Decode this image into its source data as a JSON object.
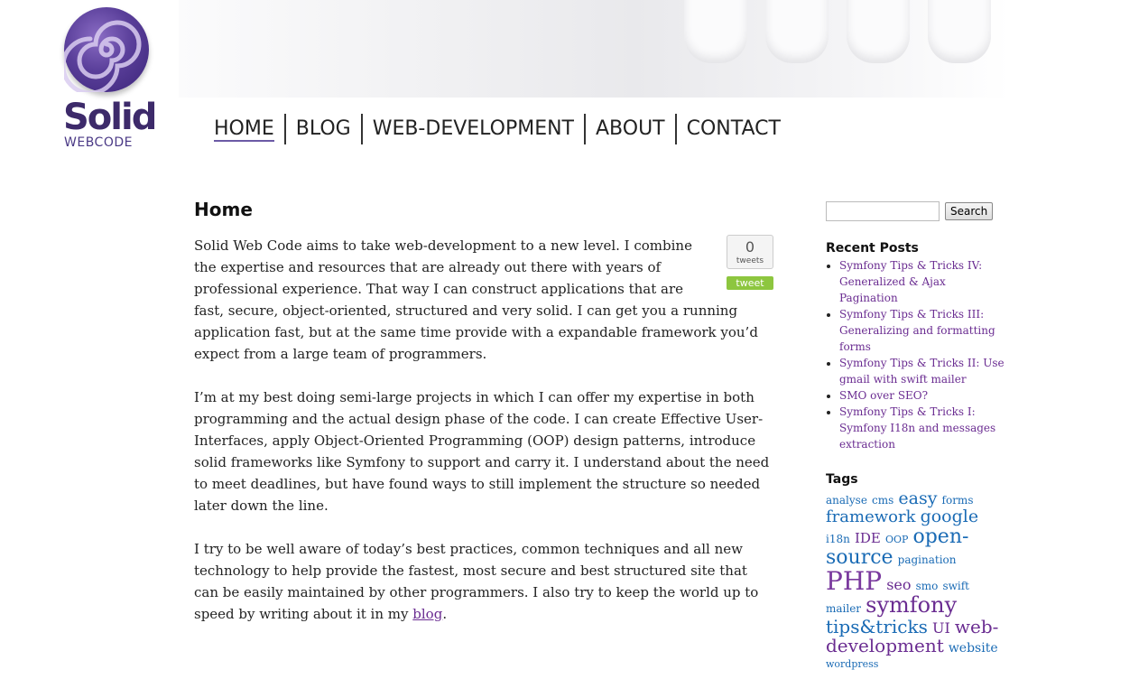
{
  "site": {
    "logo_word": "Solid",
    "logo_sub": "WEBCODE"
  },
  "nav": [
    "HOME",
    "BLOG",
    "WEB-DEVELOPMENT",
    "ABOUT",
    "CONTACT"
  ],
  "page": {
    "title": "Home",
    "paragraphs": [
      "Solid Web Code aims to take web-development to a new level. I combine the expertise and resources that are already out there with years of professional experience. That way I can construct applications that are fast, secure, object-oriented, structured and very solid. I can get you a running application fast, but at the same time provide with a expandable framework you’d expect from a large team of programmers.",
      "I’m at my best doing semi-large projects in which I can offer my expertise in both programming and the actual design phase of the code. I can create Effective User-Interfaces, apply Object-Oriented Programming (OOP) design patterns, introduce solid frameworks like Symfony to support and carry it. I understand about the need to meet deadlines, but have found ways to still implement the structure so needed later down the line.",
      "I try to be well aware of today’s best practices, common techniques and all new technology to help provide the fastest, most secure and best structured site that can be easily maintained by other programmers. I also try to keep the world up to speed by writing about it in my"
    ],
    "blog_link": "blog",
    "period": "."
  },
  "tweet": {
    "count": "0",
    "label": "tweets",
    "button": "tweet"
  },
  "sidebar": {
    "search_button": "Search",
    "search_value": "",
    "recent_title": "Recent Posts",
    "recent_posts": [
      "Symfony Tips & Tricks IV: Generalized & Ajax Pagination",
      "Symfony Tips & Tricks III: Generalizing and formatting forms",
      "Symfony Tips & Tricks II: Use gmail with swift mailer",
      "SMO over SEO?",
      "Symfony Tips & Tricks I: Symfony I18n and messages extraction"
    ],
    "tags_title": "Tags",
    "tags": [
      {
        "text": "analyse",
        "size": 12,
        "color": "#1a6bb5"
      },
      {
        "text": "cms",
        "size": 12,
        "color": "#1a6bb5"
      },
      {
        "text": "easy",
        "size": 19,
        "color": "#1a6bb5"
      },
      {
        "text": "forms",
        "size": 12,
        "color": "#1a6bb5"
      },
      {
        "text": "framework",
        "size": 18,
        "color": "#1a6bb5"
      },
      {
        "text": "google",
        "size": 19,
        "color": "#1a6bb5"
      },
      {
        "text": "i18n",
        "size": 12,
        "color": "#1a6bb5"
      },
      {
        "text": "IDE",
        "size": 15,
        "color": "#6a2c91"
      },
      {
        "text": "OOP",
        "size": 11,
        "color": "#1a6bb5"
      },
      {
        "text": "open-source",
        "size": 22,
        "color": "#1a6bb5"
      },
      {
        "text": "pagination",
        "size": 12,
        "color": "#1a6bb5"
      },
      {
        "text": "PHP",
        "size": 28,
        "color": "#7a3a9e"
      },
      {
        "text": "seo",
        "size": 16,
        "color": "#6a2c91"
      },
      {
        "text": "smo",
        "size": 12,
        "color": "#1a6bb5"
      },
      {
        "text": "swift mailer",
        "size": 12,
        "color": "#1a6bb5"
      },
      {
        "text": "symfony",
        "size": 24,
        "color": "#6a2c91"
      },
      {
        "text": "tips&tricks",
        "size": 20,
        "color": "#1a6bb5"
      },
      {
        "text": "UI",
        "size": 16,
        "color": "#6a2c91"
      },
      {
        "text": "web-development",
        "size": 20,
        "color": "#6a2c91"
      },
      {
        "text": "website",
        "size": 14,
        "color": "#1a6bb5"
      },
      {
        "text": "wordpress",
        "size": 11,
        "color": "#1a6bb5"
      }
    ]
  },
  "colors": {
    "logo_purple": "#4b3a86",
    "link": "#6a2c91",
    "tweet_green": "#8dc63f"
  }
}
